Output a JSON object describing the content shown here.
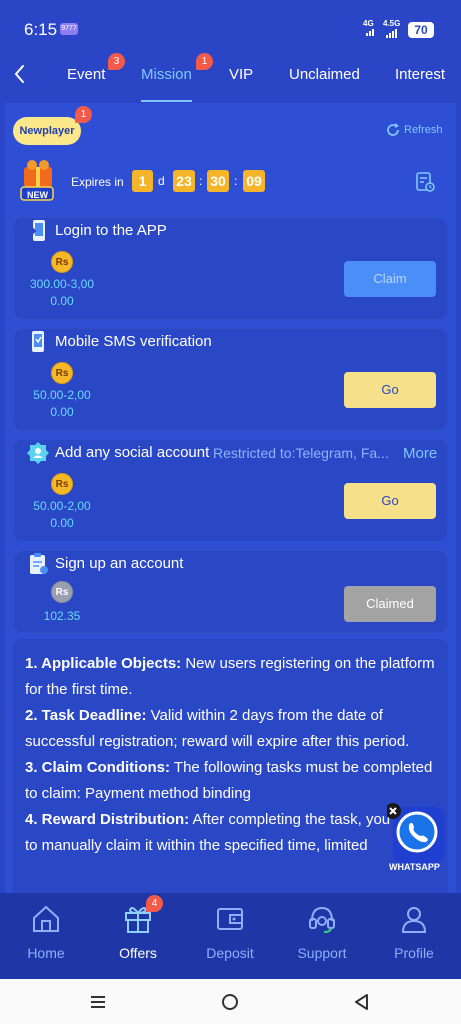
{
  "status_bar": {
    "time": "6:15",
    "app_badge": "9777",
    "net1": "4G",
    "net2": "4.5G",
    "battery": "70"
  },
  "tabs": [
    {
      "label": "Event",
      "badge": "3"
    },
    {
      "label": "Mission",
      "badge": "1",
      "active": true
    },
    {
      "label": "VIP"
    },
    {
      "label": "Unclaimed"
    },
    {
      "label": "Interest"
    }
  ],
  "newplayer": {
    "label": "Newplayer",
    "badge": "1"
  },
  "refresh_label": "Refresh",
  "gift_new_label": "NEW",
  "countdown": {
    "label": "Expires in",
    "days": "1",
    "day_unit": "d",
    "hours": "23",
    "minutes": "30",
    "seconds": "09",
    "sep": ":"
  },
  "tasks": [
    {
      "title": "Login to the APP",
      "currency": "Rs",
      "range": "300.00-3,00",
      "value": "0.00",
      "button": "Claim",
      "icon": "phone-login-icon"
    },
    {
      "title": "Mobile SMS verification",
      "currency": "Rs",
      "range": "50.00-2,00",
      "value": "0.00",
      "button": "Go",
      "icon": "mobile-sms-icon"
    },
    {
      "title": "Add any social account",
      "restriction": "Restricted to:Telegram, Fa...",
      "more": "More",
      "currency": "Rs",
      "range": "50.00-2,00",
      "value": "0.00",
      "button": "Go",
      "icon": "social-account-icon"
    },
    {
      "title": "Sign up an account",
      "currency": "Rs",
      "value": "102.35",
      "button": "Claimed",
      "icon": "signup-clipboard-icon"
    }
  ],
  "rules": [
    {
      "heading": "1. Applicable Objects:",
      "text": " New users registering on the platform for the first time."
    },
    {
      "heading": "2. Task Deadline:",
      "text": " Valid within 2 days from the date of successful registration; reward will expire after this period."
    },
    {
      "heading": "3. Claim Conditions:",
      "text": " The following tasks must be completed to claim: Payment method binding"
    },
    {
      "heading": "4. Reward Distribution:",
      "text": " After completing the task, you need to manually claim it within the specified time, limited"
    }
  ],
  "whatsapp_label": "WHATSAPP",
  "bottom_nav": [
    {
      "label": "Home",
      "icon": "home-icon"
    },
    {
      "label": "Offers",
      "icon": "gift-icon",
      "badge": "4",
      "active": true
    },
    {
      "label": "Deposit",
      "icon": "wallet-icon"
    },
    {
      "label": "Support",
      "icon": "headset-icon"
    },
    {
      "label": "Profile",
      "icon": "user-icon"
    }
  ],
  "colors": {
    "background": "#2a46c7",
    "accent": "#7ec8ff",
    "countdown": "#f5b52b",
    "go_button": "#f7e08a",
    "claim_button": "#4c8ef7",
    "badge": "#f45a4a"
  }
}
